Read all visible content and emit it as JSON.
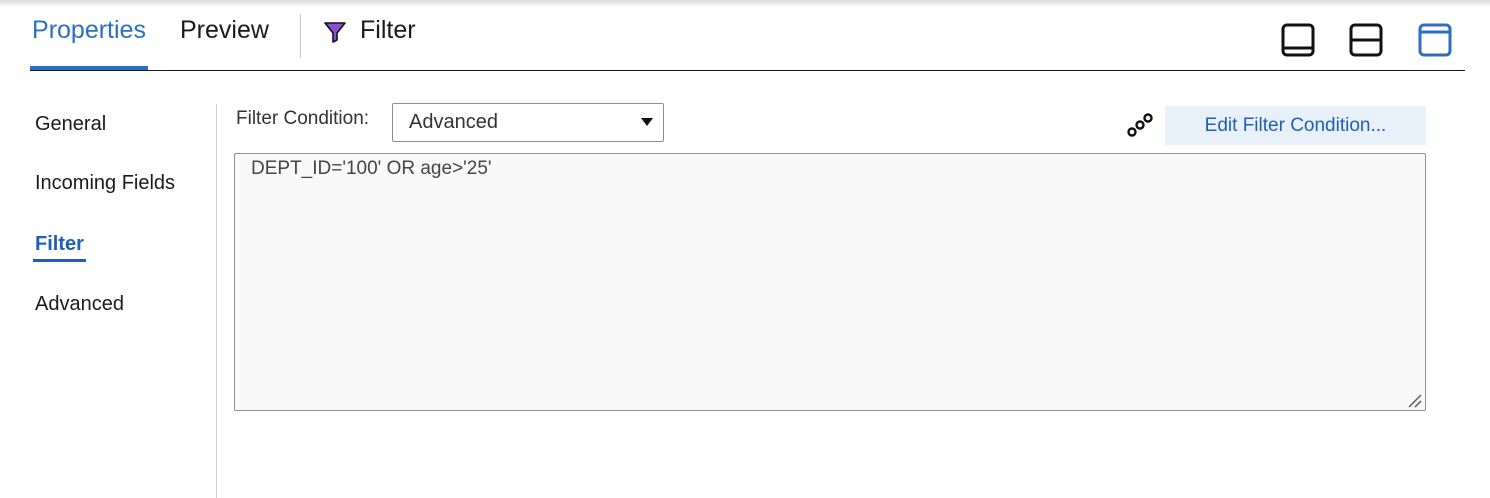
{
  "header": {
    "tabs": [
      {
        "label": "Properties",
        "active": true
      },
      {
        "label": "Preview",
        "active": false
      },
      {
        "label": "Filter",
        "icon": "funnel-icon",
        "active": false
      }
    ],
    "layout_buttons": [
      "panel-bottom-icon",
      "panel-split-icon",
      "panel-maximize-icon"
    ],
    "accent_color": "#2a6fc4"
  },
  "sidebar": {
    "items": [
      {
        "label": "General",
        "active": false
      },
      {
        "label": "Incoming Fields",
        "active": false
      },
      {
        "label": "Filter",
        "active": true
      },
      {
        "label": "Advanced",
        "active": false
      }
    ]
  },
  "main": {
    "filter_condition_label": "Filter Condition:",
    "filter_condition_value": "Advanced",
    "edit_button_label": "Edit Filter Condition...",
    "chain_icon": "link-chain-icon",
    "condition_text": "DEPT_ID='100' OR age>'25'"
  }
}
